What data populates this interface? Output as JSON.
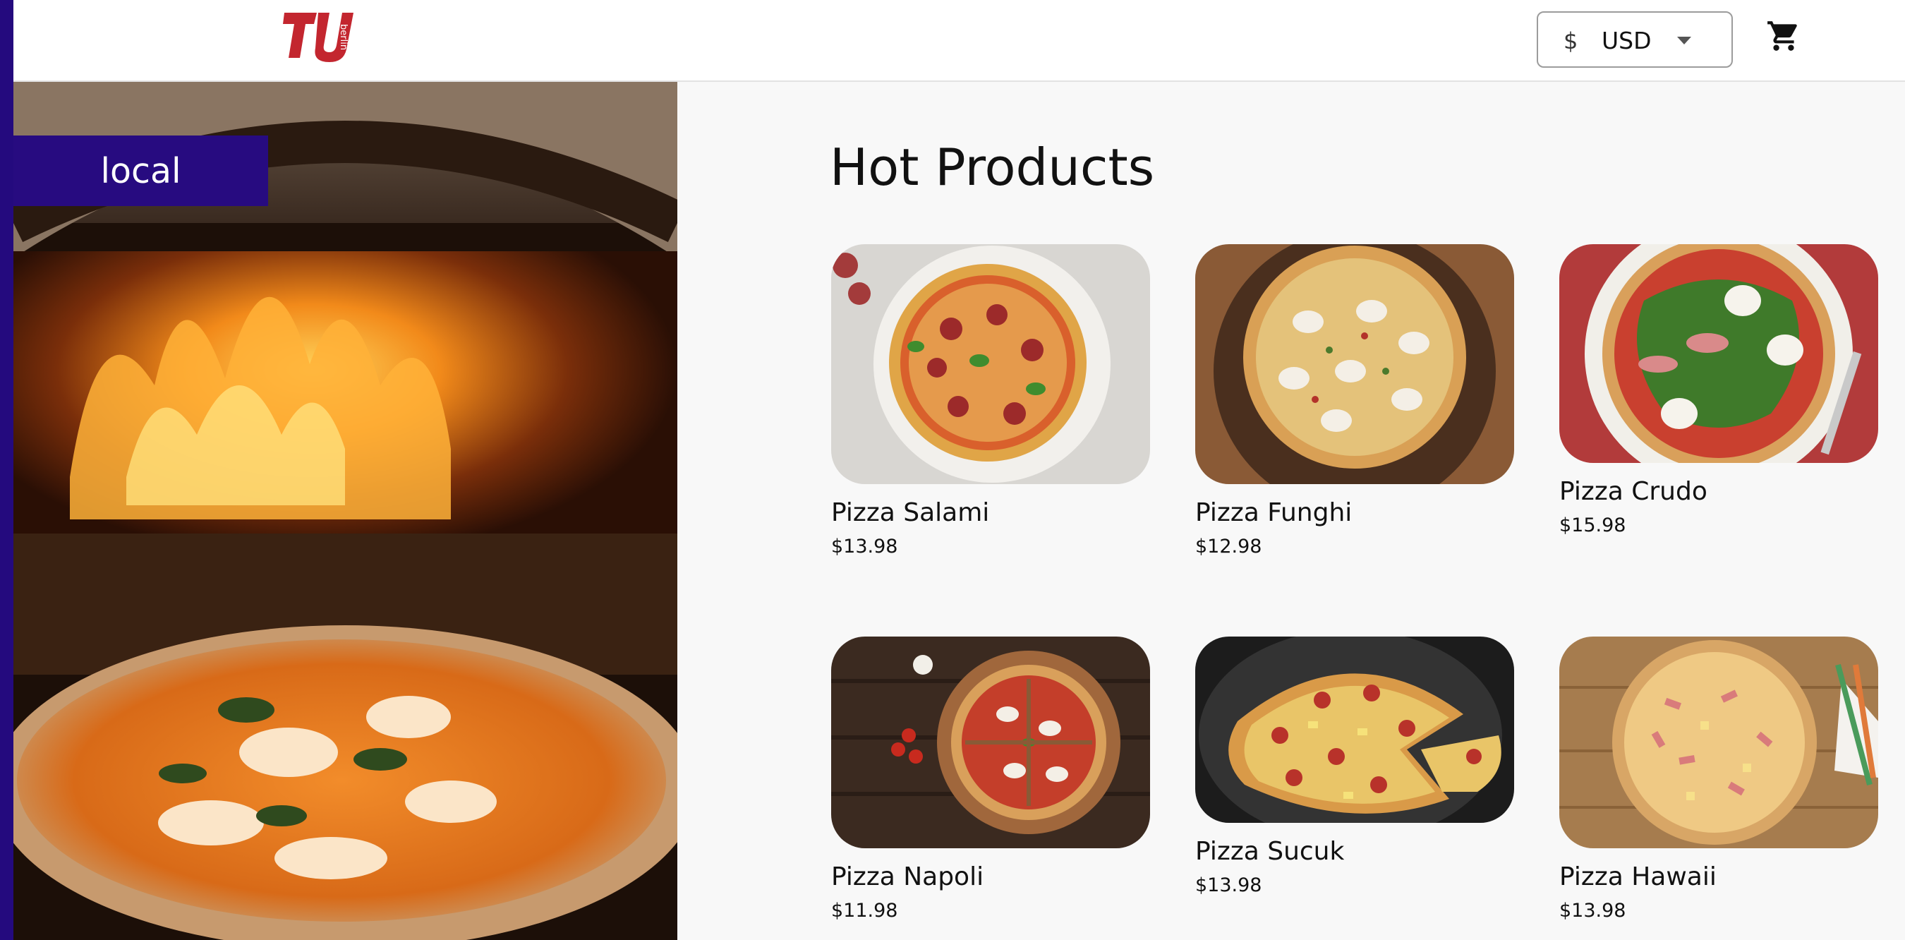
{
  "header": {
    "logo_text": "TU",
    "logo_subtext": "berlin",
    "currency": {
      "symbol": "$",
      "code": "USD"
    },
    "cart_icon": "shopping-cart-icon"
  },
  "hero": {
    "location_label": "local"
  },
  "main": {
    "title": "Hot Products",
    "products": [
      {
        "name": "Pizza Salami",
        "price": "$13.98"
      },
      {
        "name": "Pizza Funghi",
        "price": "$12.98"
      },
      {
        "name": "Pizza Crudo",
        "price": "$15.98"
      },
      {
        "name": "Pizza Napoli",
        "price": "$11.98"
      },
      {
        "name": "Pizza Sucuk",
        "price": "$13.98"
      },
      {
        "name": "Pizza Hawaii",
        "price": "$13.98"
      }
    ]
  },
  "colors": {
    "brand_purple": "#240a7e",
    "logo_red": "#c3262f"
  }
}
